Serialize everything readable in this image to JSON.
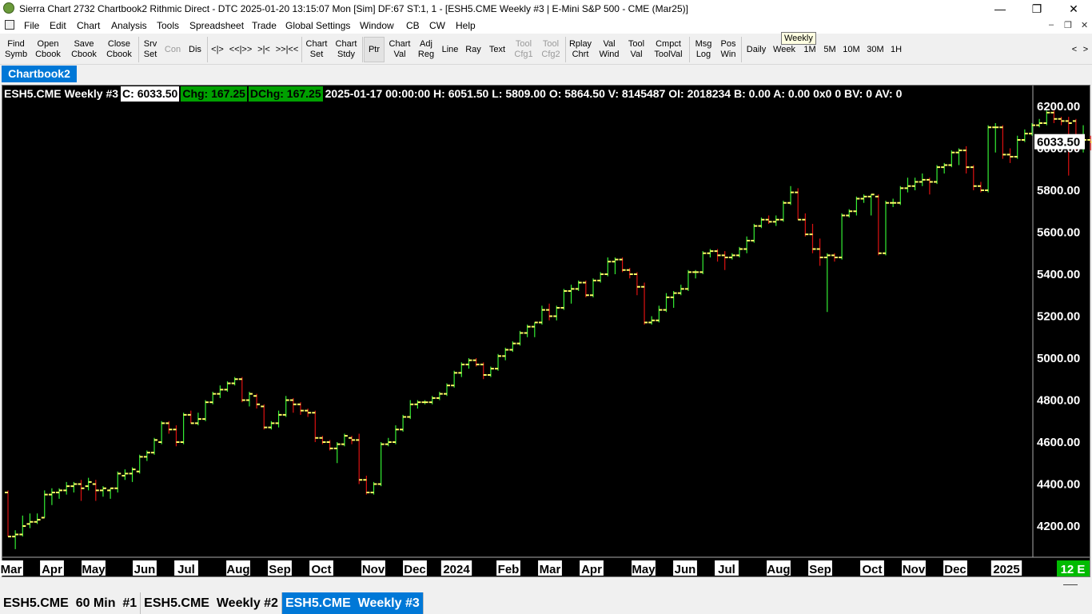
{
  "window": {
    "title": "Sierra Chart 2732 Chartbook2 Rithmic Direct - DTC 2025-01-20  13:15:07 Mon [Sim] DF:67  ST:1, 1 - [ESH5.CME  Weekly #3 | E-Mini S&P 500 - CME (Mar25)]",
    "minimize": "—",
    "restore": "❐",
    "close": "✕"
  },
  "menu": {
    "items": [
      "File",
      "Edit",
      "Chart",
      "Analysis",
      "Tools",
      "Spreadsheet",
      "Trade",
      "Global Settings",
      "Window",
      "CB",
      "CW",
      "Help"
    ],
    "mdi_buttons": [
      "–",
      "❐",
      "✕"
    ]
  },
  "toolbar": {
    "buttons": [
      {
        "label": "Find\nSymb",
        "state": "normal"
      },
      {
        "label": "Open\nCbook",
        "state": "normal"
      },
      {
        "label": "Save\nCbook",
        "state": "normal"
      },
      {
        "label": "Close\nCbook",
        "state": "normal"
      },
      {
        "label": "Srv\nSet",
        "state": "normal"
      },
      {
        "label": "Con",
        "state": "disabled"
      },
      {
        "label": "Dis",
        "state": "normal"
      },
      {
        "label": "<|>",
        "state": "normal"
      },
      {
        "label": "<<|>>",
        "state": "normal"
      },
      {
        "label": ">|<",
        "state": "normal"
      },
      {
        "label": ">>|<<",
        "state": "normal"
      },
      {
        "label": "Chart\nSet",
        "state": "normal"
      },
      {
        "label": "Chart\nStdy",
        "state": "normal"
      },
      {
        "label": "Ptr",
        "state": "pressed"
      },
      {
        "label": "Chart\nVal",
        "state": "normal"
      },
      {
        "label": "Adj\nReg",
        "state": "normal"
      },
      {
        "label": "Line",
        "state": "normal"
      },
      {
        "label": "Ray",
        "state": "normal"
      },
      {
        "label": "Text",
        "state": "normal"
      },
      {
        "label": "Tool\nCfg1",
        "state": "disabled"
      },
      {
        "label": "Tool\nCfg2",
        "state": "disabled"
      },
      {
        "label": "Rplay\nChrt",
        "state": "normal"
      },
      {
        "label": "Val\nWind",
        "state": "normal"
      },
      {
        "label": "Tool\nVal",
        "state": "normal"
      },
      {
        "label": "Cmpct\nToolVal",
        "state": "normal"
      },
      {
        "label": "Msg\nLog",
        "state": "normal"
      },
      {
        "label": "Pos\nWin",
        "state": "normal"
      },
      {
        "label": "Daily",
        "state": "normal"
      },
      {
        "label": "Week",
        "state": "normal"
      },
      {
        "label": "1M",
        "state": "normal"
      },
      {
        "label": "5M",
        "state": "normal"
      },
      {
        "label": "10M",
        "state": "normal"
      },
      {
        "label": "30M",
        "state": "normal"
      },
      {
        "label": "1H",
        "state": "normal"
      }
    ],
    "scroll_left": "<",
    "scroll_right": ">",
    "tooltip": "Weekly"
  },
  "chartbook_tab": "Chartbook2",
  "chart_header": {
    "symbol": "ESH5.CME",
    "name": "Weekly #3",
    "close": "C: 6033.50",
    "chg": "Chg: 167.25",
    "dchg": "DChg: 167.25",
    "bar_info": "2025-01-17 00:00:00 H: 6051.50 L: 5809.00 O: 5864.50 V: 8145487 OI: 2018234 B: 0.00 A: 0.00 0x0 0 BV: 0 AV: 0"
  },
  "price_axis": {
    "labels": [
      "6200.00",
      "6000.00",
      "5800.00",
      "5600.00",
      "5400.00",
      "5200.00",
      "5000.00",
      "4800.00",
      "4600.00",
      "4400.00",
      "4200.00"
    ],
    "last_price_label": "6033.50"
  },
  "time_axis": {
    "labels": [
      "Mar",
      "Apr",
      "May",
      "Jun",
      "Jul",
      "Aug",
      "Sep",
      "Oct",
      "Nov",
      "Dec",
      "2024",
      "Feb",
      "Mar",
      "Apr",
      "May",
      "Jun",
      "Jul",
      "Aug",
      "Sep",
      "Oct",
      "Nov",
      "Dec",
      "2025"
    ],
    "badge": "12 E"
  },
  "colors": {
    "up_bar": "#33ee33",
    "down_bar": "#dd1111",
    "open_close_tick": "#ffff66",
    "background": "#000000",
    "axis_text": "#ffffff",
    "active_tab": "#0078d7",
    "change_bg": "#00a000",
    "badge_bg": "#00bb00"
  },
  "chart_data": {
    "type": "ohlc",
    "ylim": [
      4060,
      6280
    ],
    "series": [
      {
        "values": [
          [
            4360,
            4370,
            4150,
            4150
          ],
          [
            4150,
            4180,
            4090,
            4160
          ],
          [
            4160,
            4250,
            4150,
            4200
          ],
          [
            4210,
            4260,
            4190,
            4220
          ],
          [
            4220,
            4260,
            4210,
            4230
          ],
          [
            4240,
            4370,
            4240,
            4350
          ],
          [
            4350,
            4380,
            4300,
            4360
          ],
          [
            4360,
            4380,
            4330,
            4370
          ],
          [
            4370,
            4410,
            4350,
            4390
          ],
          [
            4390,
            4410,
            4360,
            4400
          ],
          [
            4400,
            4420,
            4320,
            4380
          ],
          [
            4390,
            4430,
            4370,
            4410
          ],
          [
            4400,
            4420,
            4320,
            4370
          ],
          [
            4370,
            4390,
            4340,
            4380
          ],
          [
            4370,
            4380,
            4330,
            4380
          ],
          [
            4380,
            4460,
            4360,
            4450
          ],
          [
            4440,
            4470,
            4420,
            4450
          ],
          [
            4450,
            4480,
            4410,
            4470
          ],
          [
            4460,
            4540,
            4450,
            4530
          ],
          [
            4530,
            4560,
            4510,
            4550
          ],
          [
            4550,
            4620,
            4540,
            4610
          ],
          [
            4600,
            4700,
            4590,
            4690
          ],
          [
            4690,
            4700,
            4640,
            4660
          ],
          [
            4660,
            4680,
            4580,
            4600
          ],
          [
            4600,
            4740,
            4590,
            4730
          ],
          [
            4730,
            4750,
            4690,
            4690
          ],
          [
            4690,
            4740,
            4680,
            4710
          ],
          [
            4710,
            4800,
            4700,
            4790
          ],
          [
            4790,
            4840,
            4780,
            4830
          ],
          [
            4830,
            4870,
            4810,
            4850
          ],
          [
            4850,
            4890,
            4840,
            4880
          ],
          [
            4880,
            4910,
            4870,
            4900
          ],
          [
            4900,
            4910,
            4790,
            4800
          ],
          [
            4800,
            4840,
            4770,
            4830
          ],
          [
            4820,
            4830,
            4760,
            4780
          ],
          [
            4770,
            4780,
            4660,
            4670
          ],
          [
            4670,
            4700,
            4660,
            4690
          ],
          [
            4690,
            4750,
            4670,
            4730
          ],
          [
            4730,
            4820,
            4720,
            4800
          ],
          [
            4800,
            4810,
            4740,
            4780
          ],
          [
            4780,
            4790,
            4730,
            4750
          ],
          [
            4750,
            4760,
            4720,
            4740
          ],
          [
            4740,
            4750,
            4600,
            4620
          ],
          [
            4620,
            4630,
            4590,
            4600
          ],
          [
            4600,
            4610,
            4560,
            4570
          ],
          [
            4570,
            4600,
            4500,
            4590
          ],
          [
            4590,
            4640,
            4580,
            4630
          ],
          [
            4620,
            4630,
            4590,
            4610
          ],
          [
            4610,
            4640,
            4400,
            4420
          ],
          [
            4420,
            4440,
            4350,
            4360
          ],
          [
            4360,
            4410,
            4350,
            4400
          ],
          [
            4400,
            4600,
            4390,
            4590
          ],
          [
            4590,
            4620,
            4580,
            4600
          ],
          [
            4600,
            4680,
            4590,
            4660
          ],
          [
            4660,
            4730,
            4650,
            4720
          ],
          [
            4720,
            4800,
            4710,
            4780
          ],
          [
            4780,
            4800,
            4760,
            4790
          ],
          [
            4790,
            4800,
            4780,
            4790
          ],
          [
            4790,
            4820,
            4780,
            4810
          ],
          [
            4810,
            4840,
            4800,
            4830
          ],
          [
            4830,
            4880,
            4820,
            4870
          ],
          [
            4870,
            4940,
            4860,
            4930
          ],
          [
            4930,
            4980,
            4910,
            4970
          ],
          [
            4970,
            5000,
            4950,
            4990
          ],
          [
            4990,
            5000,
            4960,
            4970
          ],
          [
            4970,
            4980,
            4900,
            4920
          ],
          [
            4920,
            4960,
            4910,
            4950
          ],
          [
            4950,
            5020,
            4940,
            5010
          ],
          [
            5010,
            5050,
            4990,
            5040
          ],
          [
            5040,
            5080,
            5030,
            5070
          ],
          [
            5070,
            5130,
            5060,
            5120
          ],
          [
            5120,
            5160,
            5100,
            5150
          ],
          [
            5150,
            5170,
            5100,
            5170
          ],
          [
            5170,
            5250,
            5160,
            5230
          ],
          [
            5230,
            5260,
            5180,
            5200
          ],
          [
            5200,
            5250,
            5180,
            5240
          ],
          [
            5240,
            5330,
            5230,
            5320
          ],
          [
            5320,
            5350,
            5260,
            5330
          ],
          [
            5330,
            5370,
            5320,
            5360
          ],
          [
            5360,
            5370,
            5290,
            5300
          ],
          [
            5300,
            5380,
            5290,
            5370
          ],
          [
            5370,
            5410,
            5360,
            5400
          ],
          [
            5400,
            5480,
            5390,
            5460
          ],
          [
            5460,
            5480,
            5400,
            5470
          ],
          [
            5470,
            5480,
            5410,
            5420
          ],
          [
            5420,
            5430,
            5380,
            5400
          ],
          [
            5400,
            5410,
            5300,
            5340
          ],
          [
            5340,
            5360,
            5160,
            5170
          ],
          [
            5170,
            5200,
            5160,
            5180
          ],
          [
            5180,
            5250,
            5170,
            5230
          ],
          [
            5230,
            5310,
            5220,
            5290
          ],
          [
            5290,
            5320,
            5240,
            5310
          ],
          [
            5310,
            5350,
            5300,
            5330
          ],
          [
            5330,
            5420,
            5320,
            5410
          ],
          [
            5410,
            5420,
            5380,
            5410
          ],
          [
            5410,
            5510,
            5400,
            5500
          ],
          [
            5500,
            5520,
            5480,
            5510
          ],
          [
            5510,
            5520,
            5460,
            5490
          ],
          [
            5490,
            5510,
            5420,
            5480
          ],
          [
            5480,
            5500,
            5470,
            5490
          ],
          [
            5490,
            5530,
            5480,
            5520
          ],
          [
            5520,
            5580,
            5500,
            5560
          ],
          [
            5560,
            5640,
            5550,
            5630
          ],
          [
            5630,
            5670,
            5620,
            5660
          ],
          [
            5660,
            5680,
            5640,
            5650
          ],
          [
            5650,
            5680,
            5630,
            5660
          ],
          [
            5660,
            5750,
            5650,
            5740
          ],
          [
            5740,
            5820,
            5730,
            5790
          ],
          [
            5790,
            5810,
            5660,
            5660
          ],
          [
            5660,
            5690,
            5580,
            5590
          ],
          [
            5590,
            5640,
            5500,
            5520
          ],
          [
            5520,
            5570,
            5440,
            5480
          ],
          [
            5480,
            5500,
            5220,
            5490
          ],
          [
            5490,
            5500,
            5460,
            5480
          ],
          [
            5480,
            5690,
            5470,
            5680
          ],
          [
            5680,
            5710,
            5670,
            5700
          ],
          [
            5700,
            5770,
            5680,
            5760
          ],
          [
            5760,
            5780,
            5740,
            5770
          ],
          [
            5770,
            5780,
            5680,
            5780
          ],
          [
            5770,
            5780,
            5490,
            5500
          ],
          [
            5500,
            5750,
            5490,
            5740
          ],
          [
            5740,
            5760,
            5720,
            5740
          ],
          [
            5740,
            5820,
            5730,
            5810
          ],
          [
            5810,
            5860,
            5790,
            5820
          ],
          [
            5820,
            5860,
            5800,
            5840
          ],
          [
            5840,
            5880,
            5820,
            5850
          ],
          [
            5850,
            5860,
            5780,
            5840
          ],
          [
            5840,
            5920,
            5830,
            5910
          ],
          [
            5910,
            5930,
            5880,
            5920
          ],
          [
            5920,
            5990,
            5910,
            5980
          ],
          [
            5980,
            6000,
            5920,
            5990
          ],
          [
            5990,
            6010,
            5880,
            5910
          ],
          [
            5910,
            5920,
            5800,
            5820
          ],
          [
            5820,
            5840,
            5790,
            5800
          ],
          [
            5800,
            6110,
            5790,
            6100
          ],
          [
            6100,
            6120,
            5980,
            6100
          ],
          [
            6100,
            6110,
            5950,
            5970
          ],
          [
            5970,
            6000,
            5930,
            5960
          ],
          [
            5960,
            6060,
            5950,
            6040
          ],
          [
            6040,
            6090,
            6030,
            6070
          ],
          [
            6070,
            6120,
            6060,
            6110
          ],
          [
            6110,
            6140,
            6100,
            6120
          ],
          [
            6120,
            6180,
            6110,
            6170
          ],
          [
            6170,
            6180,
            6120,
            6140
          ],
          [
            6140,
            6150,
            6110,
            6130
          ],
          [
            6130,
            6150,
            5870,
            6120
          ],
          [
            6130,
            6140,
            5990,
            6000
          ],
          [
            6000,
            6110,
            5980,
            6040
          ],
          [
            6040,
            6060,
            5990,
            6030
          ],
          [
            6030,
            6040,
            5880,
            6000
          ],
          [
            6000,
            6030,
            5990,
            6010
          ],
          [
            6010,
            6070,
            5850,
            5860
          ],
          [
            5864.5,
            6051.5,
            5809,
            6033.5
          ]
        ]
      }
    ]
  },
  "chart_tabs": [
    "ESH5.CME  60 Min  #1",
    "ESH5.CME  Weekly #2",
    "ESH5.CME  Weekly #3"
  ]
}
